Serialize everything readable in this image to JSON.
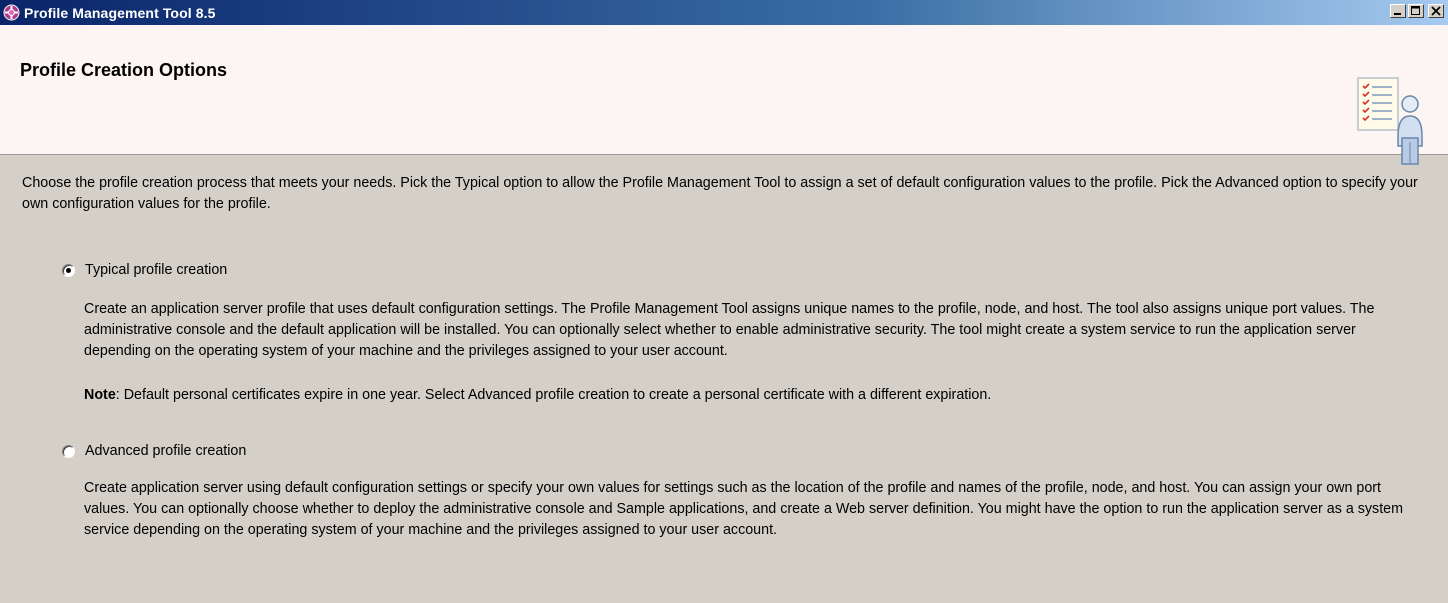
{
  "window": {
    "title": "Profile Management Tool 8.5",
    "controls": {
      "minimize": "_",
      "maximize": "□",
      "close": "X"
    }
  },
  "header": {
    "title": "Profile Creation Options"
  },
  "content": {
    "intro": "Choose the profile creation process that meets your needs. Pick the Typical option to allow the Profile Management Tool to assign a set of default configuration values to the profile. Pick the Advanced option to specify your own configuration values for the profile.",
    "options": [
      {
        "label": "Typical profile creation",
        "selected": true,
        "description": "Create an application server profile that uses default configuration settings. The Profile Management Tool assigns unique names to the profile, node, and host. The tool also assigns unique port values. The administrative console and the default application will be installed. You can optionally select whether to enable administrative security. The tool might create a system service to run the application server depending on the operating system of your machine and the privileges assigned to your user account.",
        "note_label": "Note",
        "note_text": ": Default personal certificates expire in one year.  Select Advanced profile creation to create a personal certificate with a different expiration."
      },
      {
        "label": "Advanced profile creation",
        "selected": false,
        "description": "Create application server using default configuration settings or specify your own values for settings such as the location of the profile and names of the profile, node, and host. You can assign your own port values. You can optionally choose whether to deploy the administrative console and Sample applications, and create a Web server definition. You might have the option to run the application server as a system service depending on the operating system of your machine and the privileges assigned to your user account."
      }
    ]
  },
  "colors": {
    "titlebar_start": "#0a246a",
    "titlebar_end": "#a6caf0",
    "header_bg": "#fdf4f4",
    "content_bg": "#d4d0c8"
  },
  "icons": {
    "app": "app-logo-icon",
    "header": "profile-checklist-person-icon"
  }
}
